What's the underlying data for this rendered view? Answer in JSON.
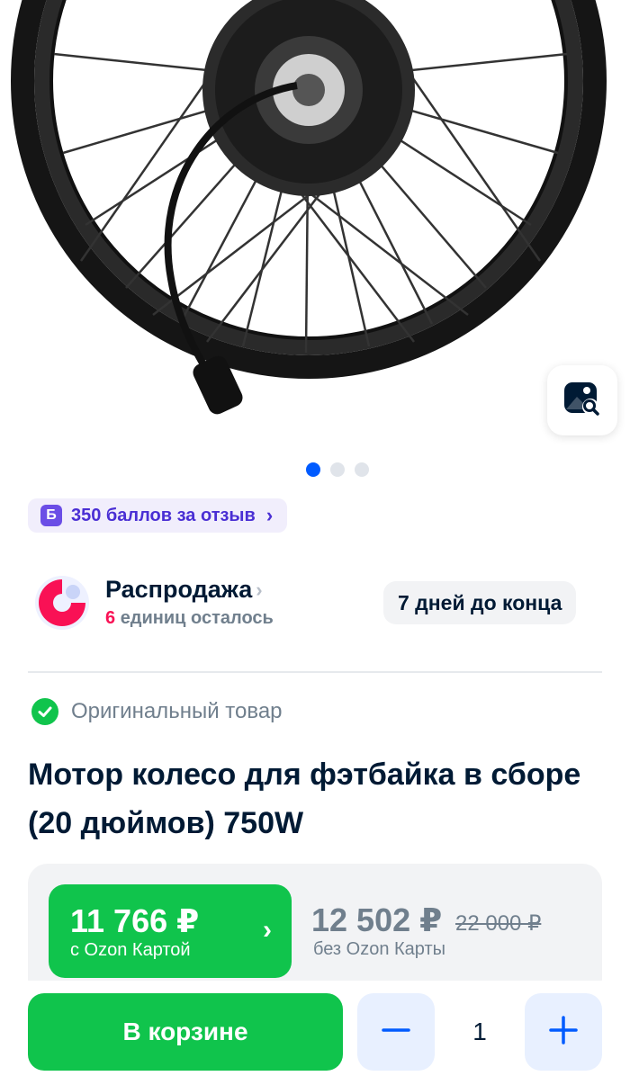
{
  "gallery": {
    "image_alt": "Мотор колесо",
    "dots_count": 3,
    "active_dot": 0
  },
  "bonus": {
    "badge": "Б",
    "label": "350 баллов за отзыв"
  },
  "sale": {
    "title": "Распродажа",
    "units_num": "6",
    "units_text": "единиц осталось",
    "days_left": "7 дней до конца"
  },
  "product": {
    "original_label": "Оригинальный товар",
    "title": "Мотор колесо для фэтбайка в сборе (20 дюймов) 750W"
  },
  "price": {
    "ozon_price": "11 766 ₽",
    "ozon_caption": "с Ozon Картой",
    "regular_price": "12 502 ₽",
    "old_price": "22 000 ₽",
    "regular_caption": "без Ozon Карты"
  },
  "cart": {
    "button_label": "В корзине",
    "quantity": "1"
  },
  "colors": {
    "accent_green": "#10c44c",
    "brand_blue": "#005bff",
    "bonus_purple": "#6b4ee6",
    "sale_pink": "#f91155"
  },
  "icons": [
    "visual-search-icon",
    "chevron-right-icon",
    "check-icon",
    "minus-icon",
    "plus-icon",
    "sale-logo-icon"
  ]
}
